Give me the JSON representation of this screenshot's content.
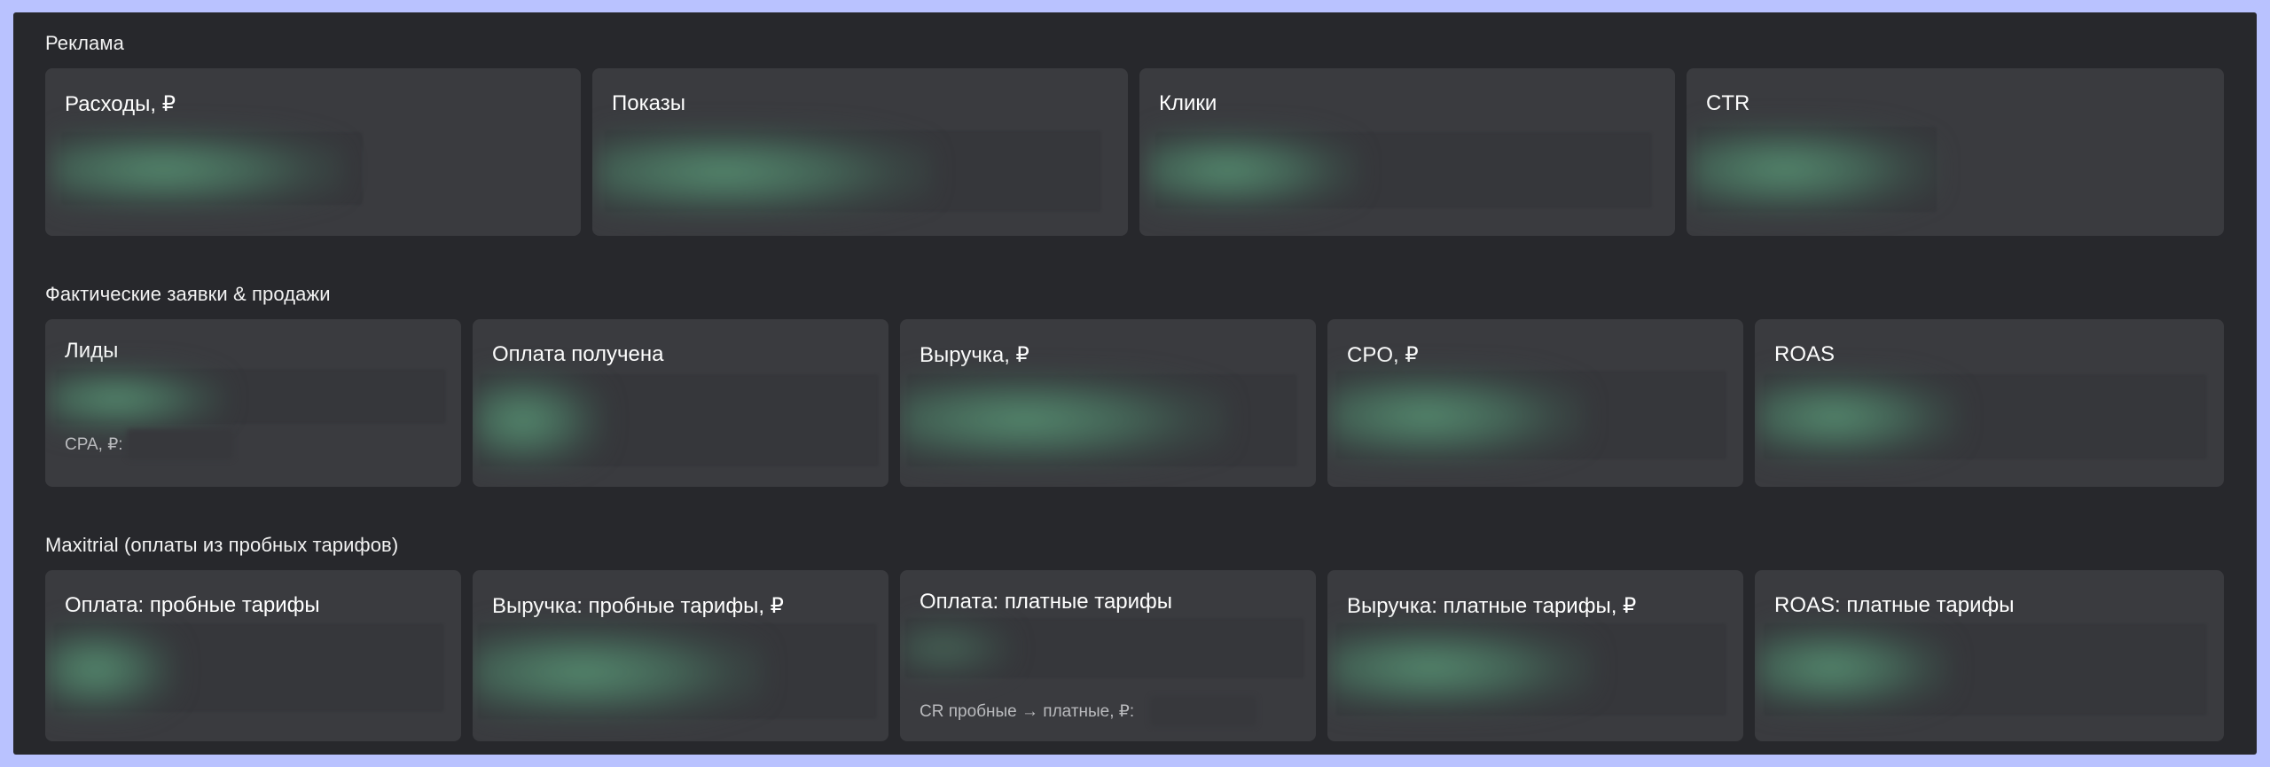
{
  "sections": [
    {
      "title": "Реклама",
      "cards": [
        {
          "title": "Расходы, ₽"
        },
        {
          "title": "Показы"
        },
        {
          "title": "Клики"
        },
        {
          "title": "CTR"
        }
      ]
    },
    {
      "title": "Фактические заявки & продажи",
      "cards": [
        {
          "title": "Лиды",
          "sub": "CPA, ₽:"
        },
        {
          "title": "Оплата получена"
        },
        {
          "title": "Выручка, ₽"
        },
        {
          "title": "CPO, ₽"
        },
        {
          "title": "ROAS"
        }
      ]
    },
    {
      "title": "Maxitrial (оплаты из пробных тарифов)",
      "cards": [
        {
          "title": "Оплата: пробные тарифы"
        },
        {
          "title": "Выручка: пробные тарифы, ₽"
        },
        {
          "title": "Оплата: платные тарифы",
          "sub": "CR пробные → платные, ₽:"
        },
        {
          "title": "Выручка: платные тарифы, ₽"
        },
        {
          "title": "ROAS: платные тарифы"
        }
      ]
    }
  ]
}
